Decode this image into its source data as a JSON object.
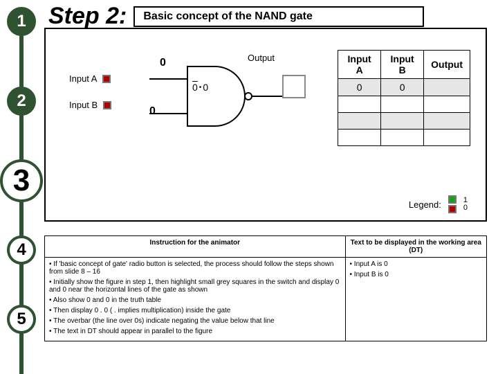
{
  "timeline": {
    "nodes": [
      "1",
      "2",
      "3",
      "4",
      "5"
    ]
  },
  "header": {
    "step": "Step 2:",
    "title": "Basic concept of the NAND gate"
  },
  "diagram": {
    "inputA_label": "Input A",
    "inputB_label": "Input B",
    "bitA": "0",
    "bitB": "0",
    "gate_expr_left": "0",
    "gate_expr_right": "0",
    "output_label": "Output"
  },
  "truth_table": {
    "headers": [
      "Input A",
      "Input B",
      "Output"
    ],
    "rows": [
      [
        "0",
        "0",
        ""
      ],
      [
        "",
        "",
        ""
      ],
      [
        "",
        "",
        ""
      ],
      [
        "",
        "",
        ""
      ]
    ]
  },
  "legend": {
    "label": "Legend:",
    "high": "1",
    "low": "0"
  },
  "instructions": {
    "col1_header": "Instruction for the animator",
    "col2_header": "Text to be displayed in the working area (DT)",
    "animator_steps": [
      "If 'basic concept of gate' radio button is selected, the process should follow the steps shown from slide 8 – 16",
      "Initially show the figure in step 1, then highlight small grey squares in the switch and display 0 and 0 near the horizontal lines of the gate as shown",
      "Also show 0 and 0 in the truth table",
      "Then display 0 . 0 ( . implies multiplication) inside the gate",
      "The overbar (the line over 0s) indicate negating the value below that line",
      "The text in DT should appear in parallel to the figure"
    ],
    "dt_steps": [
      "Input A is 0",
      "Input B is 0"
    ]
  }
}
